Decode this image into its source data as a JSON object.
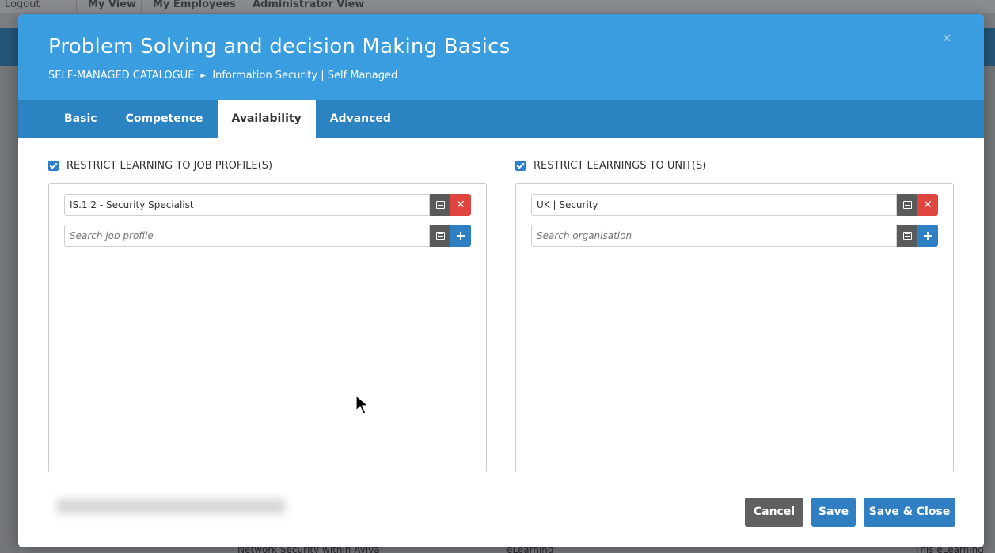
{
  "background": {
    "logout": "Logout",
    "tabs": [
      "My View",
      "My Employees",
      "Administrator View"
    ],
    "bottom_text": "Network Security within Aviva",
    "bottom_mid": "eLearning",
    "bottom_right": "This eLearning"
  },
  "modal": {
    "title": "Problem Solving and decision Making Basics",
    "breadcrumb": {
      "root": "SELF-MANAGED CATALOGUE",
      "separator": "►",
      "current": "Information Security | Self Managed"
    },
    "close_icon": "×",
    "tabs": [
      {
        "label": "Basic",
        "active": false
      },
      {
        "label": "Competence",
        "active": false
      },
      {
        "label": "Availability",
        "active": true
      },
      {
        "label": "Advanced",
        "active": false
      }
    ]
  },
  "left_panel": {
    "checkbox_label": "RESTRICT LEARNING TO JOB PROFILE(S)",
    "checked": true,
    "selected_value": "IS.1.2 - Security Specialist",
    "search_placeholder": "Search job profile"
  },
  "right_panel": {
    "checkbox_label": "RESTRICT LEARNINGS TO UNIT(S)",
    "checked": true,
    "selected_value": "UK | Security",
    "search_placeholder": "Search organisation"
  },
  "footer": {
    "cancel_label": "Cancel",
    "save_label": "Save",
    "save_close_label": "Save & Close"
  },
  "colors": {
    "header_blue": "#3a9de0",
    "tab_bar_blue": "#2c83c2",
    "primary_button": "#2f7fc2",
    "cancel_button": "#5e6062",
    "remove_red": "#e0443f"
  }
}
